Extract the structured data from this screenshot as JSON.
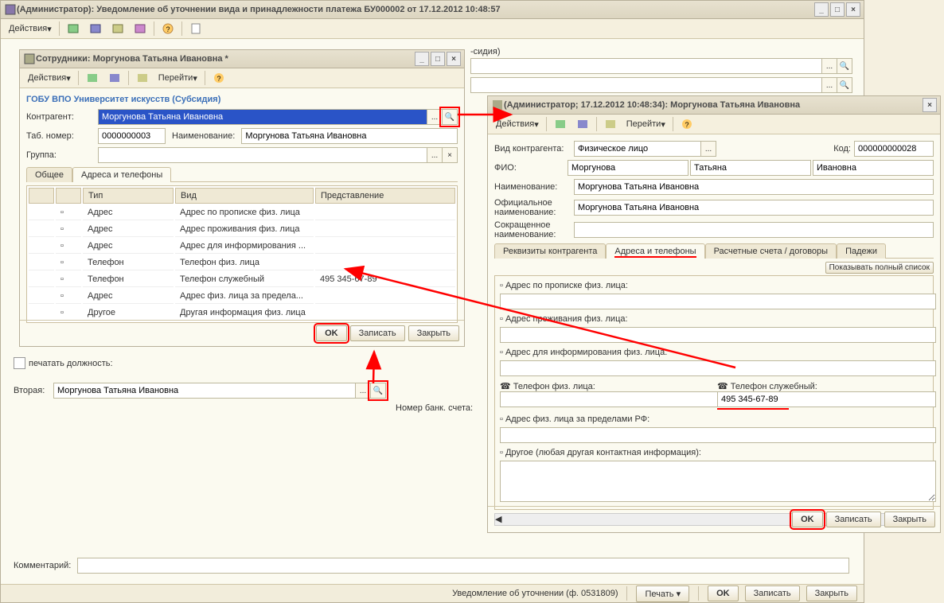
{
  "mainWindow": {
    "title": "(Администратор): Уведомление об уточнении вида и принадлежности платежа БУ000002 от 17.12.2012 10:48:57",
    "actions": "Действия",
    "sidiaLabel": "-сидия)",
    "printPost": "печатать должность:",
    "vtoraya": "Вторая:",
    "vtorayaVal": "Моргунова Татьяна Ивановна",
    "bankAccount": "Номер банк. счета:",
    "comment": "Комментарий:",
    "statusText": "Уведомление об уточнении (ф. 0531809)",
    "printBtn": "Печать",
    "okBtn": "OK",
    "saveBtn": "Записать",
    "closeBtn": "Закрыть"
  },
  "empWindow": {
    "title": "Сотрудники: Моргунова Татьяна Ивановна *",
    "actions": "Действия",
    "go": "Перейти",
    "orgLine": "ГОБУ ВПО Университет искусств (Субсидия)",
    "counterparty": "Контрагент:",
    "counterpartyVal": "Моргунова Татьяна Ивановна",
    "tabNum": "Таб. номер:",
    "tabNumVal": "0000000003",
    "naim": "Наименование:",
    "naimVal": "Моргунова Татьяна Ивановна",
    "group": "Группа:",
    "tabCommon": "Общее",
    "tabAddr": "Адреса и телефоны",
    "colType": "Тип",
    "colKind": "Вид",
    "colRepr": "Представление",
    "rows": [
      {
        "t": "Адрес",
        "k": "Адрес по прописке физ. лица",
        "r": ""
      },
      {
        "t": "Адрес",
        "k": "Адрес проживания физ. лица",
        "r": ""
      },
      {
        "t": "Адрес",
        "k": "Адрес для информирования ...",
        "r": ""
      },
      {
        "t": "Телефон",
        "k": "Телефон физ. лица",
        "r": ""
      },
      {
        "t": "Телефон",
        "k": "Телефон служебный",
        "r": "495 345-67-89"
      },
      {
        "t": "Адрес",
        "k": "Адрес физ. лица за предела...",
        "r": ""
      },
      {
        "t": "Другое",
        "k": "Другая информация физ. лица",
        "r": ""
      }
    ],
    "okBtn": "OK",
    "saveBtn": "Записать",
    "closeBtn": "Закрыть"
  },
  "agentWindow": {
    "title": "(Администратор; 17.12.2012 10:48:34): Моргунова Татьяна Ивановна",
    "actions": "Действия",
    "go": "Перейти",
    "kindLabel": "Вид контрагента:",
    "kindVal": "Физическое лицо",
    "codeLabel": "Код:",
    "codeVal": "000000000028",
    "fioLabel": "ФИО:",
    "surname": "Моргунова",
    "name": "Татьяна",
    "patronymic": "Ивановна",
    "nameLabel": "Наименование:",
    "nameVal": "Моргунова Татьяна Ивановна",
    "offLabel1": "Официальное",
    "offLabel2": "наименование:",
    "offVal": "Моргунова Татьяна Ивановна",
    "shortLabel1": "Сокращенное",
    "shortLabel2": "наименование:",
    "tab1": "Реквизиты контрагента",
    "tab2": "Адреса и телефоны",
    "tab3": "Расчетные счета / договоры",
    "tab4": "Падежи",
    "fullList": "Показывать полный список",
    "addrReg": "Адрес по прописке физ. лица:",
    "addrLive": "Адрес проживания физ. лица:",
    "addrInfo": "Адрес для информирования физ. лица:",
    "phone": "Телефон физ. лица:",
    "phoneWork": "Телефон служебный:",
    "phoneWorkVal": "495 345-67-89",
    "addrAbroad": "Адрес физ. лица за пределами РФ:",
    "other": "Другое (любая другая контактная информация):",
    "okBtn": "OK",
    "saveBtn": "Записать",
    "closeBtn": "Закрыть"
  }
}
